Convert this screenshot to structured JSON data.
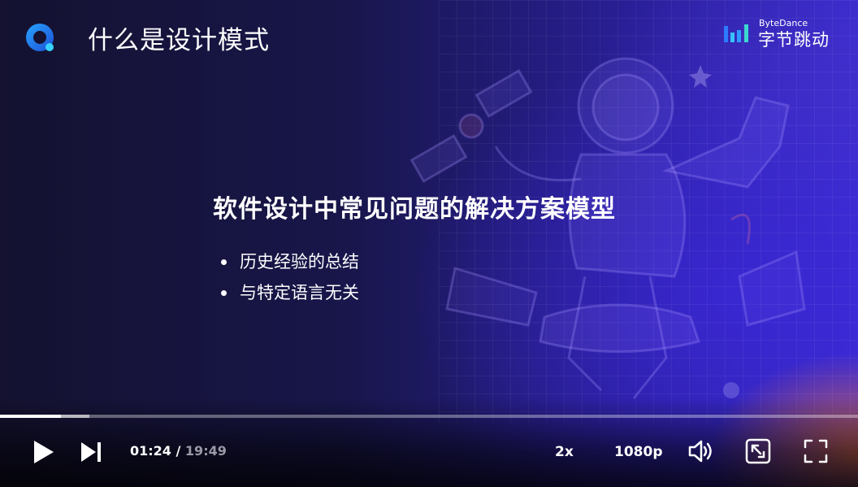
{
  "slide": {
    "title": "什么是设计模式",
    "heading": "软件设计中常见问题的解决方案模型",
    "bullets": [
      "历史经验的总结",
      "与特定语言无关"
    ],
    "brand_small": "ByteDance",
    "brand_big": "字节跳动"
  },
  "player": {
    "current_time": "01:24",
    "separator": " / ",
    "duration": "19:49",
    "progress_fraction": 0.0706,
    "buffered_fraction": 0.104,
    "speed_label": "2x",
    "quality_label": "1080p"
  },
  "icons": {
    "play": "play-icon",
    "next": "skip-next-icon",
    "volume": "volume-icon",
    "pip": "picture-in-picture-icon",
    "fullscreen": "fullscreen-icon"
  },
  "colors": {
    "accent_blue": "#1e6cff",
    "brand_blue": "#2f7bff",
    "text": "#ffffff",
    "muted_text": "#9a9aa6"
  }
}
